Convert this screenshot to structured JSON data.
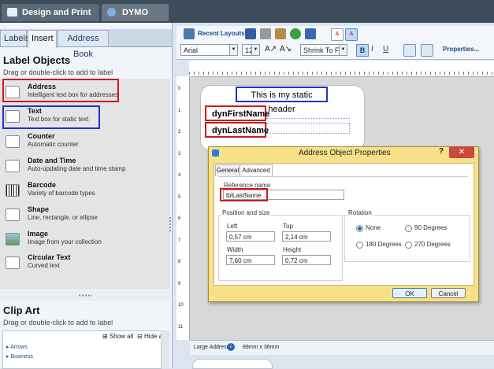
{
  "top_tabs": {
    "design_label": "Design and Print Labels",
    "online_label": "DYMO Online"
  },
  "left_tabs": [
    "Labels",
    "Insert",
    "Address Book"
  ],
  "label_objects": {
    "title": "Label Objects",
    "subtitle": "Drag or double-click to add to label",
    "items": [
      {
        "name": "Address",
        "desc": "Intelligent text box for addresses"
      },
      {
        "name": "Text",
        "desc": "Text box for static text"
      },
      {
        "name": "Counter",
        "desc": "Automatic counter"
      },
      {
        "name": "Date and Time",
        "desc": "Auto-updating date and time stamp"
      },
      {
        "name": "Barcode",
        "desc": "Variety of barcode types"
      },
      {
        "name": "Shape",
        "desc": "Line, rectangle, or ellipse"
      },
      {
        "name": "Image",
        "desc": "Image from your collection"
      },
      {
        "name": "Circular Text",
        "desc": "Curved text"
      }
    ]
  },
  "clip_art": {
    "title": "Clip Art",
    "subtitle": "Drag or double-click to add to label",
    "show_all": "Show all",
    "hide_all": "Hide all",
    "categories": [
      "Arrows",
      "Business"
    ]
  },
  "toolbar": {
    "recent_layouts": "Recent Layouts",
    "font": "Arial",
    "size": "12",
    "fit": "Shrink To Fit",
    "bold": "B",
    "italic": "I",
    "underline": "U",
    "properties": "Properties..."
  },
  "ruler_v": [
    "0",
    "1",
    "2",
    "3",
    "4",
    "5",
    "6",
    "7",
    "8",
    "9",
    "10",
    "11"
  ],
  "label": {
    "header": "This is my static header",
    "field1": "dynFirstName",
    "field2": "dynLastName"
  },
  "status": {
    "layout": "Large Address",
    "size": "89mm x 36mm"
  },
  "dialog": {
    "title": "Address Object Properties",
    "help": "?",
    "tab_general": "General",
    "tab_advanced": "Advanced",
    "reference_name_label": "Reference name",
    "reference_name_value": "lblLastName",
    "position_title": "Position and size",
    "left_label": "Left",
    "left_value": "0,57 cm",
    "top_label": "Top",
    "top_value": "2,14 cm",
    "width_label": "Width",
    "width_value": "7,60 cm",
    "height_label": "Height",
    "height_value": "0,72 cm",
    "rotation_title": "Rotation",
    "rotation_options": [
      "None",
      "90 Degrees",
      "180 Degrees",
      "270 Degrees"
    ],
    "ok": "OK",
    "cancel": "Cancel"
  },
  "colors": {
    "highlight_red": "#d21919",
    "highlight_blue": "#1e32c8",
    "dialog_bg": "#f7e08a",
    "topbar": "#3d4d5c"
  }
}
